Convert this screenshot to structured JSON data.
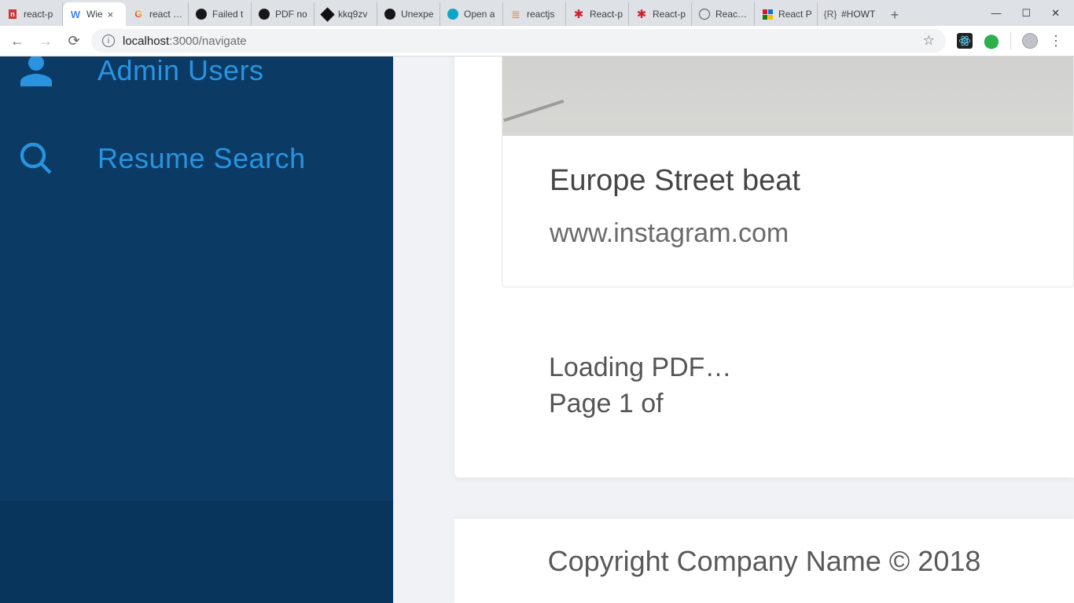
{
  "tabs": [
    {
      "label": "react-p"
    },
    {
      "label": "Wie"
    },
    {
      "label": "react pd"
    },
    {
      "label": "Failed t"
    },
    {
      "label": "PDF no"
    },
    {
      "label": "kkq9zv"
    },
    {
      "label": "Unexpe"
    },
    {
      "label": "Open a"
    },
    {
      "label": "reactjs"
    },
    {
      "label": "React-p"
    },
    {
      "label": "React-p"
    },
    {
      "label": "React-P"
    },
    {
      "label": "React P"
    },
    {
      "label": "#HOWT"
    }
  ],
  "active_tab_index": 1,
  "url": {
    "host": "localhost",
    "port": ":3000",
    "path": "/navigate"
  },
  "sidebar": {
    "admin_users": "Admin Users",
    "resume_search": "Resume Search"
  },
  "card": {
    "title": "Europe Street beat",
    "subtitle": "www.instagram.com"
  },
  "pdf": {
    "loading": "Loading PDF…",
    "page_text": "Page 1 of"
  },
  "footer": "Copyright Company Name © 2018",
  "icons": {
    "npm": "npm-icon",
    "google": "google-icon",
    "github": "github-icon",
    "codesandbox": "codesandbox-icon",
    "cloud": "cloud-icon",
    "so": "stackoverflow-icon",
    "atom": "atom-icon",
    "browser": "browser-icon",
    "grid": "grid-icon",
    "brace": "brace-icon"
  }
}
